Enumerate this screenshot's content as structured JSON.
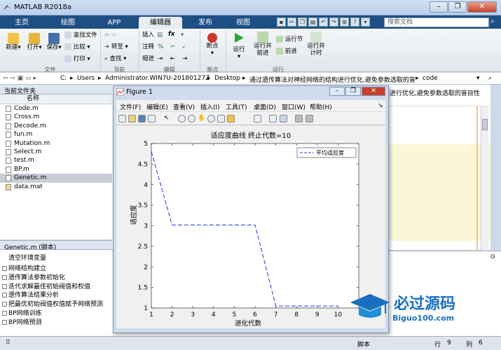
{
  "app": {
    "title": "MATLAB R2018a",
    "window_buttons": [
      "–",
      "❐",
      "✕"
    ]
  },
  "tabs": [
    "主页",
    "绘图",
    "APP",
    "编辑器",
    "发布",
    "视图"
  ],
  "search": {
    "placeholder": "搜索文档"
  },
  "ribbon": {
    "file_buttons": [
      "新建",
      "打开",
      "保存"
    ],
    "file_small": [
      "查找文件",
      "比较",
      "打印"
    ],
    "nav_small": [
      "转至",
      "查找"
    ],
    "edit_labels": [
      "插入",
      "注释",
      "缩进"
    ],
    "edit_symbols": [
      "fx",
      "%",
      "⌐"
    ],
    "breakpoint": "断点",
    "run": "运行",
    "run_advance": "运行并\n前进",
    "run_section": "运行节",
    "advance": "前进",
    "run_time": "运行并\n计时",
    "groups": [
      "文件",
      "导航",
      "编辑",
      "断点",
      "运行"
    ]
  },
  "address": {
    "parts": [
      "C:",
      "Users",
      "Administrator.WIN7U-20180127Z",
      "Desktop",
      "通过遗传算法对神经网络的结构进行优化,避免参数选取的盲目性",
      "code"
    ]
  },
  "current_folder": {
    "title": "当前文件夹",
    "column": "名称",
    "files": [
      "Code.m",
      "Cross.m",
      "Decode.m",
      "fun.m",
      "Mutation.m",
      "Select.m",
      "test.m",
      "BP.m",
      "Genetic.m",
      "data.mat"
    ],
    "selected": "Genetic.m"
  },
  "details": {
    "header": "Genetic.m  (脚本)",
    "title": "清空环境变量",
    "items": [
      "网络结构建立",
      "遗传算法参数初始化",
      "迭代求解最佳初始阀值和权值",
      "遗传算法结果分析",
      "把最优初始阀值权值赋予网络预测",
      "BP网络训练",
      "BP网络预测"
    ]
  },
  "editor": {
    "title_tail": "进行优化,避免参数选取的盲目性"
  },
  "figure": {
    "title": "Figure 1",
    "menu": [
      "文件(F)",
      "编辑(E)",
      "查看(V)",
      "插入(I)",
      "工具(T)",
      "桌面(D)",
      "窗口(W)",
      "帮助(H)"
    ]
  },
  "status": {
    "mode": "脚本",
    "line_label": "行",
    "line": "9",
    "col_label": "列",
    "col": "6"
  },
  "watermark": {
    "name": "必过源码",
    "url": "Biguo100.com"
  },
  "chart_data": {
    "type": "line",
    "title": "适应度曲线  终止代数=10",
    "xlabel": "进化代数",
    "ylabel": "适应度",
    "x": [
      1,
      2,
      3,
      4,
      5,
      6,
      7,
      8,
      9,
      10
    ],
    "series": [
      {
        "name": "平均适应度",
        "values": [
          4.8,
          3.02,
          3.02,
          3.02,
          3.02,
          3.02,
          1.05,
          1.05,
          1.05,
          1.05
        ],
        "color": "#2233dd",
        "dash": "dashed"
      }
    ],
    "xlim": [
      1,
      11
    ],
    "ylim": [
      1,
      5
    ],
    "xticks": [
      "1",
      "2",
      "3",
      "4",
      "5",
      "6",
      "7",
      "8",
      "9",
      "10"
    ],
    "yticks": [
      "1",
      "1.5",
      "2",
      "2.5",
      "3",
      "3.5",
      "4",
      "4.5",
      "5"
    ],
    "legend": "top-right",
    "grid": false
  }
}
